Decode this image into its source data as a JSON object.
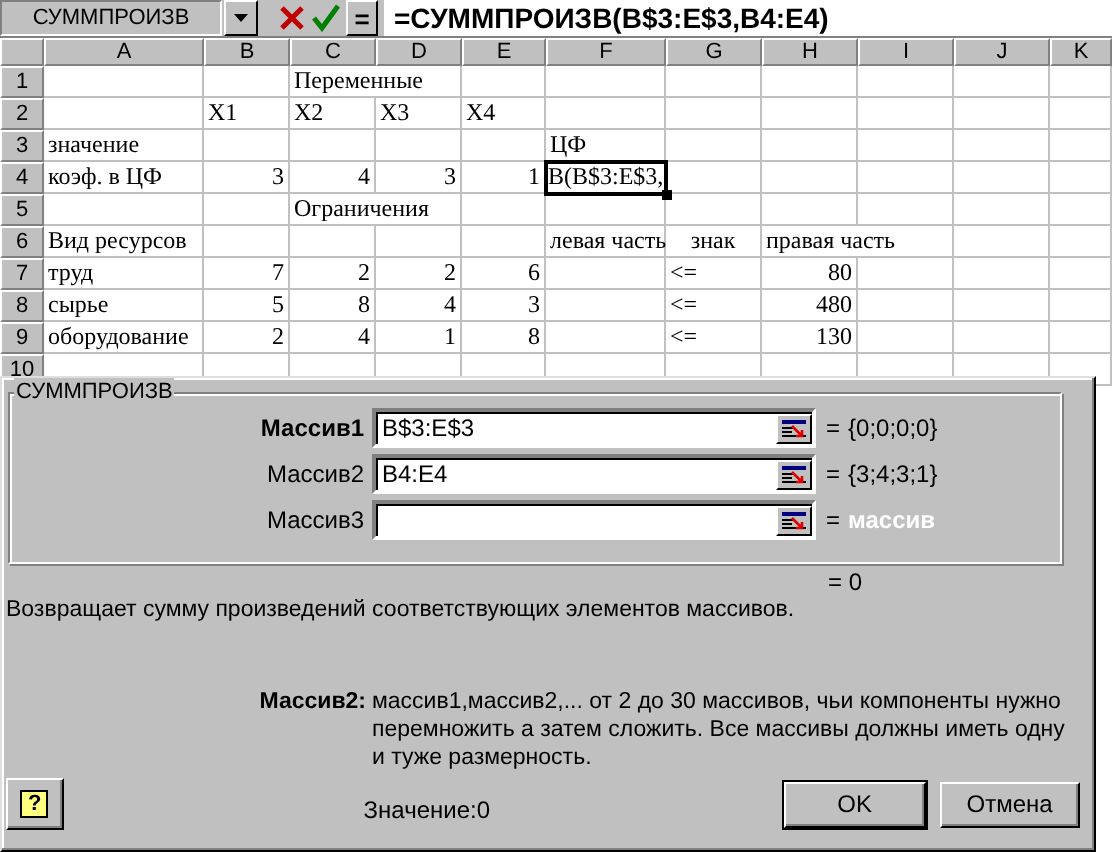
{
  "formula_bar": {
    "name_box": "СУММПРОИЗВ",
    "equals_button": "=",
    "formula": "=СУММПРОИЗВ(B$3:E$3,B4:E4)"
  },
  "sheet": {
    "columns": [
      "A",
      "B",
      "C",
      "D",
      "E",
      "F",
      "G",
      "H",
      "I",
      "J",
      "K"
    ],
    "rows": [
      {
        "number": "1",
        "cells": [
          {
            "text": "",
            "kind": "text",
            "selected": false
          },
          {
            "text": "",
            "kind": "text",
            "selected": false
          },
          {
            "text": "Переменные",
            "kind": "text",
            "selected": false
          }
        ]
      },
      {
        "number": "2",
        "cells": [
          {
            "text": "",
            "kind": "text",
            "selected": false
          },
          {
            "text": "X1",
            "kind": "text",
            "selected": false
          },
          {
            "text": "X2",
            "kind": "text",
            "selected": false
          },
          {
            "text": "X3",
            "kind": "text",
            "selected": false
          },
          {
            "text": "X4",
            "kind": "text",
            "selected": false
          }
        ]
      },
      {
        "number": "3",
        "cells": [
          {
            "text": "значение",
            "kind": "text",
            "selected": false
          },
          {
            "text": "",
            "kind": "text",
            "selected": false
          },
          {
            "text": "",
            "kind": "text",
            "selected": false
          },
          {
            "text": "",
            "kind": "text",
            "selected": false
          },
          {
            "text": "",
            "kind": "text",
            "selected": false
          },
          {
            "text": "ЦФ",
            "kind": "text",
            "selected": false
          }
        ]
      },
      {
        "number": "4",
        "cells": [
          {
            "text": "коэф. в ЦФ",
            "kind": "text",
            "selected": false
          },
          {
            "text": "3",
            "kind": "number",
            "selected": false
          },
          {
            "text": "4",
            "kind": "number",
            "selected": false
          },
          {
            "text": "3",
            "kind": "number",
            "selected": false
          },
          {
            "text": "1",
            "kind": "number",
            "selected": false
          },
          {
            "text": "B(B$3:E$3,",
            "kind": "text",
            "selected": true
          }
        ]
      },
      {
        "number": "5",
        "cells": [
          {
            "text": "",
            "kind": "text",
            "selected": false
          },
          {
            "text": "",
            "kind": "text",
            "selected": false
          },
          {
            "text": "Ограничения",
            "kind": "text",
            "selected": false
          }
        ]
      },
      {
        "number": "6",
        "cells": [
          {
            "text": "Вид ресурсов",
            "kind": "text",
            "selected": false
          },
          {
            "text": "",
            "kind": "text",
            "selected": false
          },
          {
            "text": "",
            "kind": "text",
            "selected": false
          },
          {
            "text": "",
            "kind": "text",
            "selected": false
          },
          {
            "text": "",
            "kind": "text",
            "selected": false
          },
          {
            "text": "левая часть",
            "kind": "text",
            "selected": false
          },
          {
            "text": "знак",
            "kind": "center",
            "selected": false
          },
          {
            "text": "правая часть",
            "kind": "text",
            "selected": false
          }
        ]
      },
      {
        "number": "7",
        "cells": [
          {
            "text": "труд",
            "kind": "text",
            "selected": false
          },
          {
            "text": "7",
            "kind": "number",
            "selected": false
          },
          {
            "text": "2",
            "kind": "number",
            "selected": false
          },
          {
            "text": "2",
            "kind": "number",
            "selected": false
          },
          {
            "text": "6",
            "kind": "number",
            "selected": false
          },
          {
            "text": "",
            "kind": "text",
            "selected": false
          },
          {
            "text": "<=",
            "kind": "text",
            "selected": false
          },
          {
            "text": "80",
            "kind": "number",
            "selected": false
          }
        ]
      },
      {
        "number": "8",
        "cells": [
          {
            "text": "сырье",
            "kind": "text",
            "selected": false
          },
          {
            "text": "5",
            "kind": "number",
            "selected": false
          },
          {
            "text": "8",
            "kind": "number",
            "selected": false
          },
          {
            "text": "4",
            "kind": "number",
            "selected": false
          },
          {
            "text": "3",
            "kind": "number",
            "selected": false
          },
          {
            "text": "",
            "kind": "text",
            "selected": false
          },
          {
            "text": "<=",
            "kind": "text",
            "selected": false
          },
          {
            "text": "480",
            "kind": "number",
            "selected": false
          }
        ]
      },
      {
        "number": "9",
        "cells": [
          {
            "text": "оборудование",
            "kind": "text",
            "selected": false
          },
          {
            "text": "2",
            "kind": "number",
            "selected": false
          },
          {
            "text": "4",
            "kind": "number",
            "selected": false
          },
          {
            "text": "1",
            "kind": "number",
            "selected": false
          },
          {
            "text": "8",
            "kind": "number",
            "selected": false
          },
          {
            "text": "",
            "kind": "text",
            "selected": false
          },
          {
            "text": "<=",
            "kind": "text",
            "selected": false
          },
          {
            "text": "130",
            "kind": "number",
            "selected": false
          }
        ]
      },
      {
        "number": "10",
        "cells": []
      }
    ]
  },
  "dialog": {
    "title": "СУММПРОИЗВ",
    "arguments": [
      {
        "label": "Массив1",
        "value": "B$3:E$3",
        "equals": "=",
        "result": "{0;0;0;0}",
        "selected": true
      },
      {
        "label": "Массив2",
        "value": "B4:E4",
        "equals": "=",
        "result": "{3;4;3;1}",
        "selected": false
      },
      {
        "label": "Массив3",
        "equals": "=",
        "hint": "массив",
        "selected": false
      }
    ],
    "formula_result": "= 0",
    "description": "Возвращает сумму произведений соответствующих элементов массивов.",
    "help": {
      "label": "Массив2:",
      "text": "массив1,массив2,... от 2 до 30 массивов, чьи компоненты нужно перемножить а затем сложить. Все массивы должны иметь одну и туже размерность."
    },
    "help_button": "?",
    "value_line": "Значение:0",
    "buttons": [
      "OK",
      "Отмена"
    ]
  }
}
